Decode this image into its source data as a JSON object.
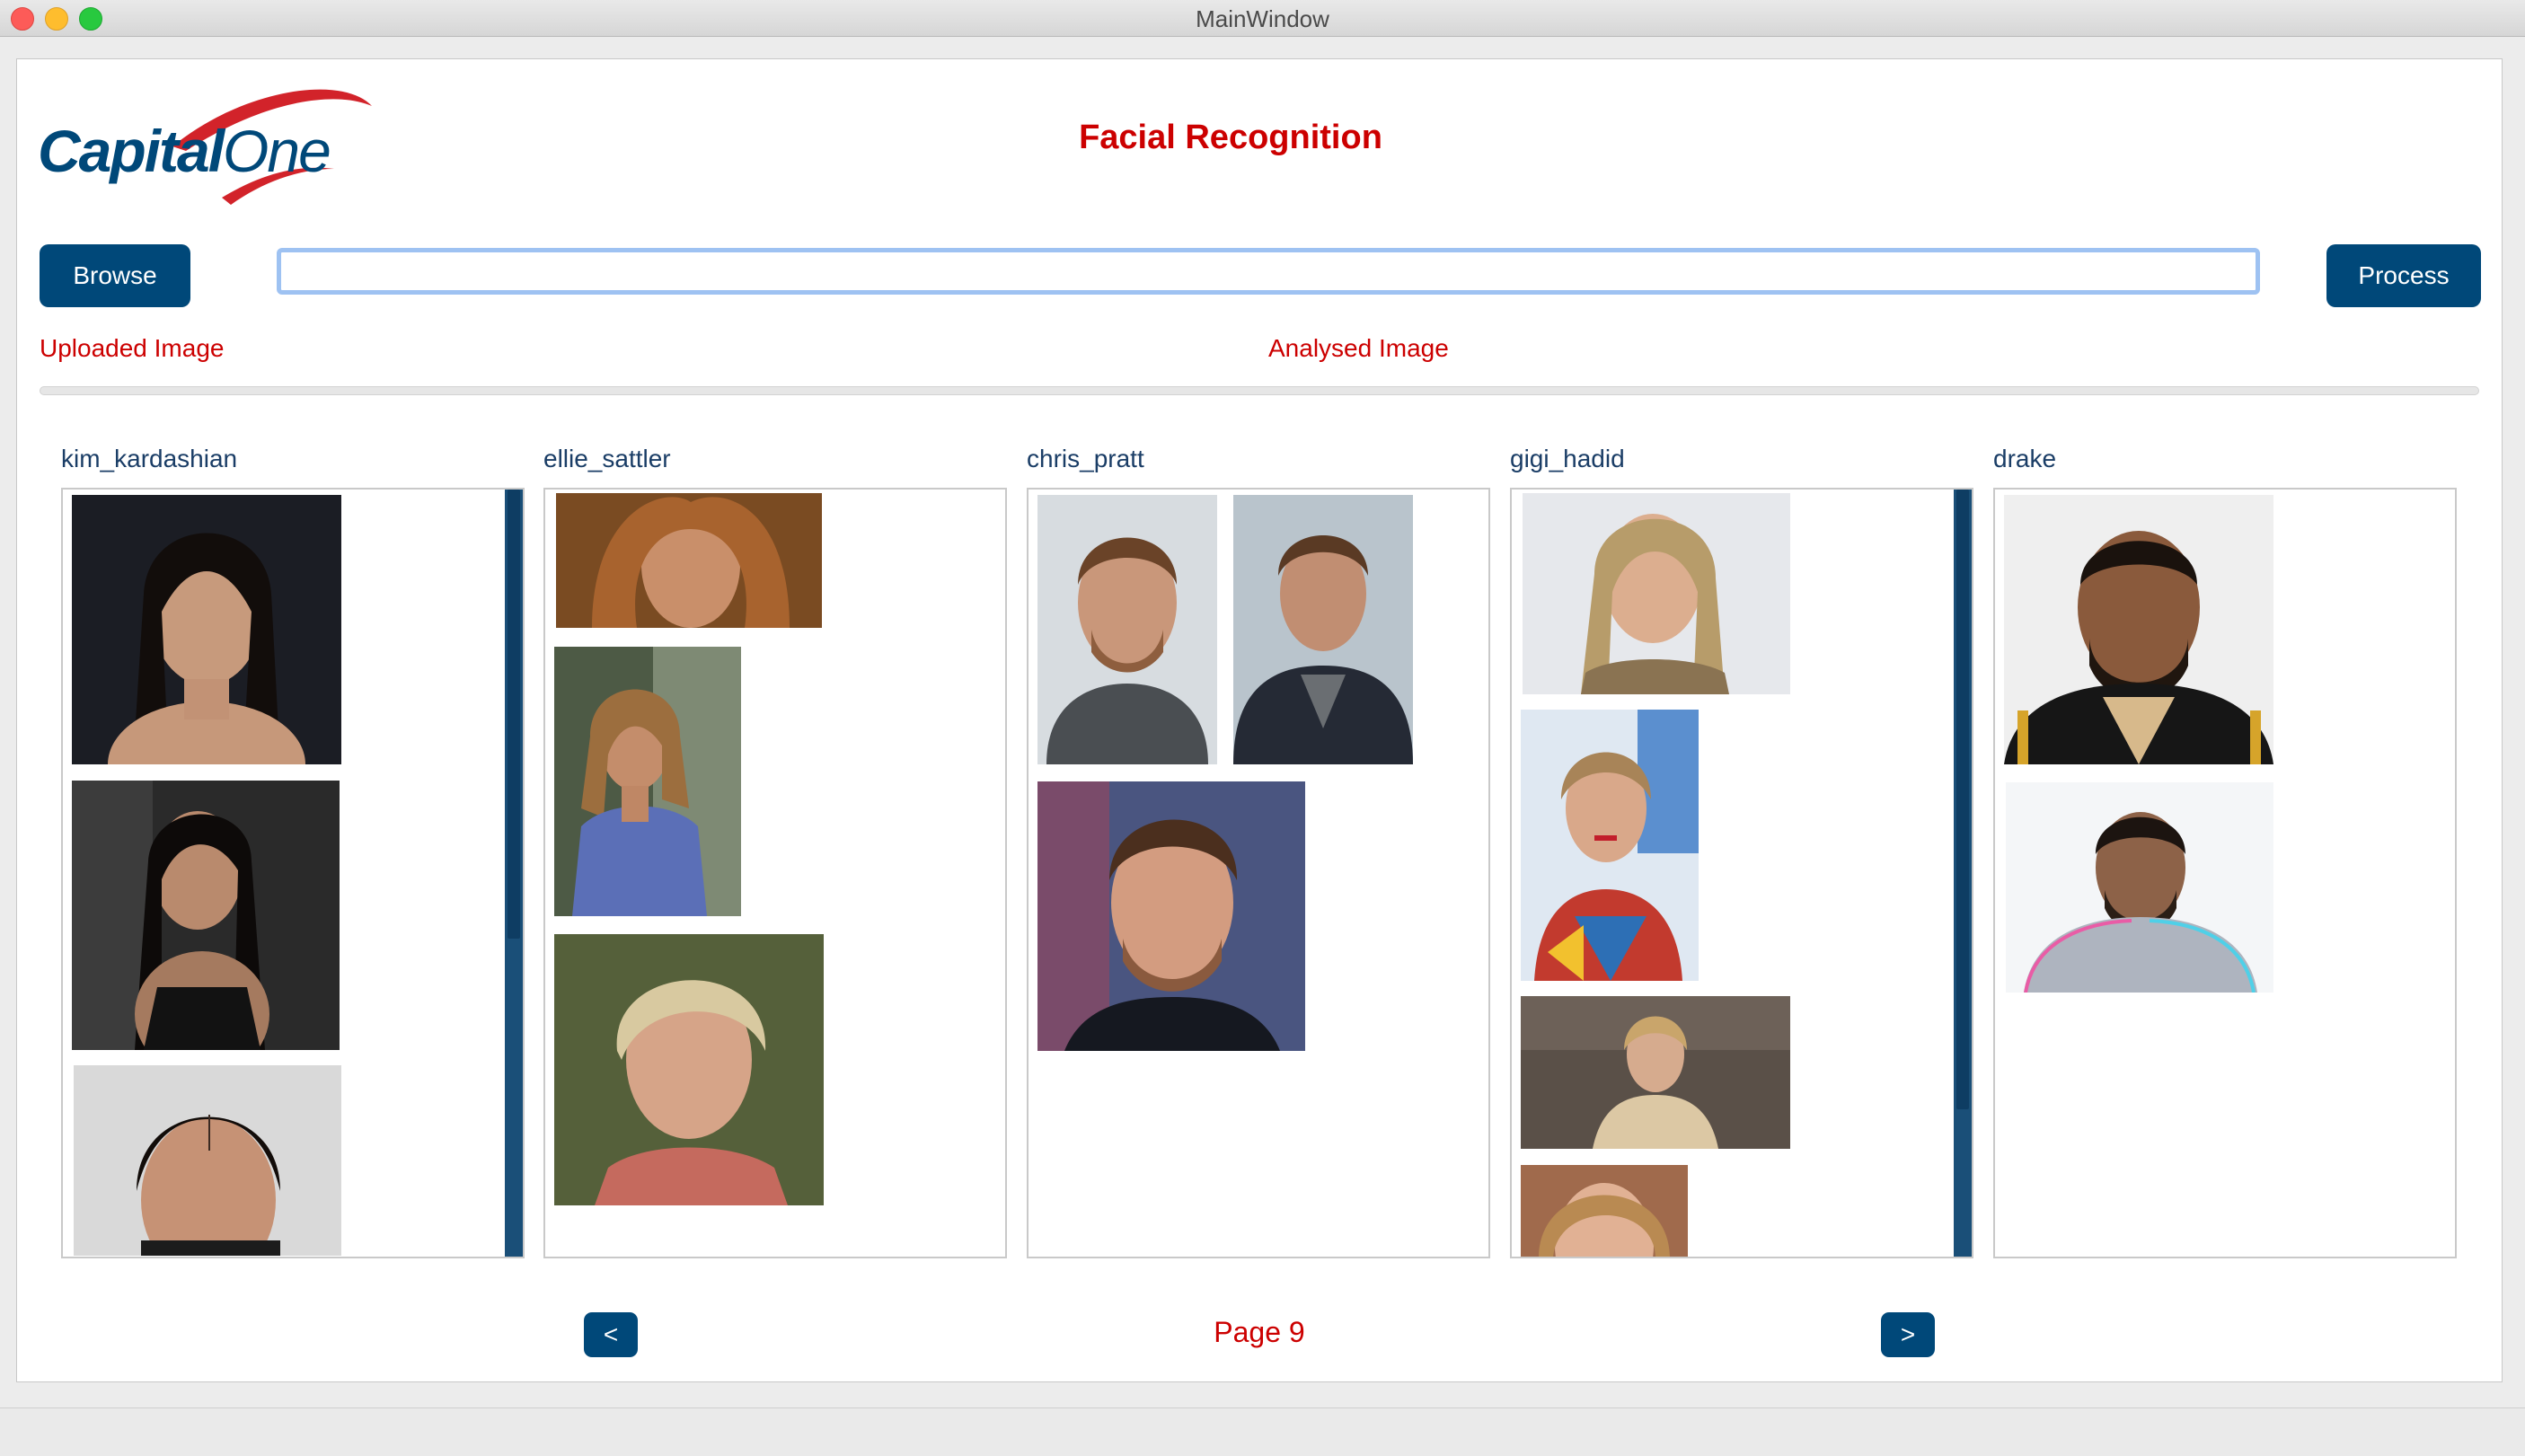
{
  "window": {
    "title": "MainWindow"
  },
  "header": {
    "logo_text_bold": "Capital",
    "logo_text_light": "One",
    "app_title": "Facial Recognition"
  },
  "controls": {
    "browse_label": "Browse",
    "process_label": "Process",
    "path_value": "",
    "path_placeholder": ""
  },
  "labels": {
    "uploaded": "Uploaded Image",
    "analysed": "Analysed Image"
  },
  "columns": [
    {
      "name": "kim_kardashian",
      "photo_count": 3,
      "scrollable": true
    },
    {
      "name": "ellie_sattler",
      "photo_count": 3,
      "scrollable": false
    },
    {
      "name": "chris_pratt",
      "photo_count": 3,
      "scrollable": false
    },
    {
      "name": "gigi_hadid",
      "photo_count": 4,
      "scrollable": true
    },
    {
      "name": "drake",
      "photo_count": 2,
      "scrollable": false
    }
  ],
  "pagination": {
    "prev_label": "<",
    "next_label": ">",
    "page_label": "Page 9"
  },
  "colors": {
    "brand_blue": "#004879",
    "brand_red": "#cc0000",
    "input_focus": "#9ec2f2"
  }
}
